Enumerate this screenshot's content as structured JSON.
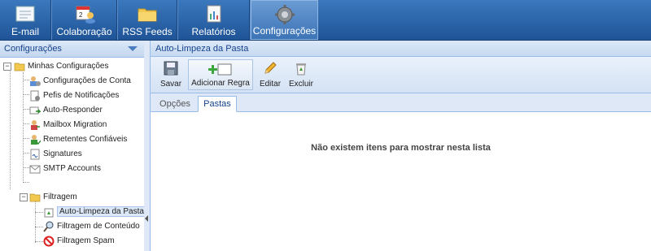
{
  "nav": {
    "items": [
      {
        "label": "E-mail",
        "icon": "email-icon"
      },
      {
        "label": "Colaboração",
        "icon": "calendar-people-icon"
      },
      {
        "label": "RSS Feeds",
        "icon": "folder-rss-icon"
      },
      {
        "label": "Relatórios",
        "icon": "report-icon"
      },
      {
        "label": "Configurações",
        "icon": "gear-icon"
      }
    ]
  },
  "sidebar": {
    "title": "Configurações",
    "tree": {
      "root": "Minhas Configurações",
      "items": [
        "Configurações de Conta",
        "Pefis de Notificações",
        "Auto-Responder",
        "Mailbox Migration",
        "Remetentes Confiáveis",
        "Signatures",
        "SMTP Accounts"
      ],
      "filter_folder": "Filtragem",
      "filter_items": [
        "Auto-Limpeza da Pasta",
        "Filtragem de Conteúdo",
        "Filtragem Spam"
      ]
    }
  },
  "main": {
    "title": "Auto-Limpeza da Pasta",
    "toolbar": {
      "save": "Savar",
      "add_rule": "Adicionar Regra",
      "edit": "Editar",
      "delete": "Excluir"
    },
    "tabs": [
      "Opções",
      "Pastas"
    ],
    "empty_message": "Não existem itens para mostrar nesta lista"
  },
  "colors": {
    "nav_bg": "#2a62a8",
    "panel_header": "#c4d7ef",
    "accent_text": "#15428b"
  }
}
